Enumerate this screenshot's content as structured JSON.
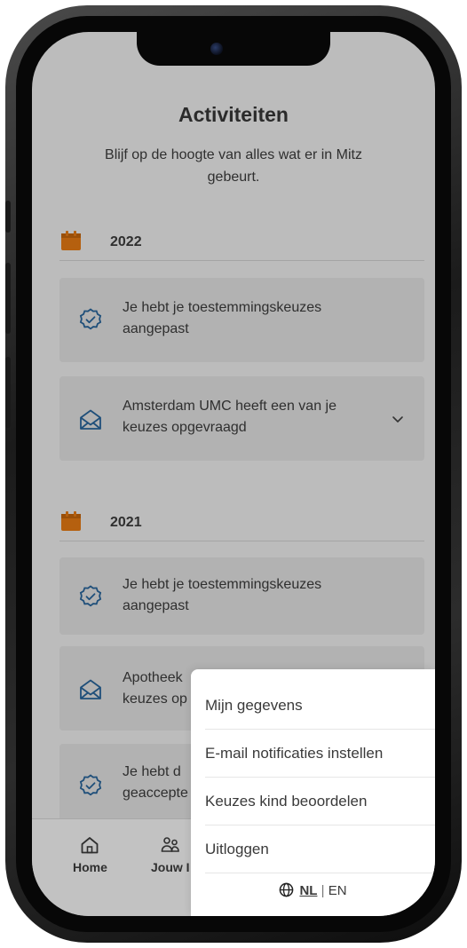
{
  "header": {
    "title": "Activiteiten",
    "subtitle": "Blijf op de hoogte van alles wat er in Mitz gebeurt."
  },
  "groups": [
    {
      "year": "2022",
      "items": [
        {
          "icon": "badge-check-icon",
          "text": "Je hebt je toestemmingskeuzes aangepast",
          "expandable": false
        },
        {
          "icon": "envelope-open-icon",
          "text": "Amsterdam UMC heeft een van je keuzes opgevraagd",
          "expandable": true
        }
      ]
    },
    {
      "year": "2021",
      "items": [
        {
          "icon": "badge-check-icon",
          "text": "Je hebt je toestemmingskeuzes aangepast",
          "expandable": false
        },
        {
          "icon": "envelope-open-icon",
          "text": "Apotheek",
          "text_line2": "keuzes op",
          "expandable": false
        },
        {
          "icon": "badge-check-icon",
          "text": "Je hebt d",
          "text_line2": "geaccepte",
          "expandable": false
        }
      ]
    }
  ],
  "bottom_nav": {
    "items": [
      {
        "icon": "home-icon",
        "label": "Home"
      },
      {
        "icon": "people-icon",
        "label": "Jouw I"
      }
    ]
  },
  "menu": {
    "items": [
      "Mijn gegevens",
      "E-mail notificaties instellen",
      "Keuzes kind beoordelen",
      "Uitloggen"
    ],
    "language": {
      "icon": "globe-icon",
      "active": "NL",
      "separator": "|",
      "other": "EN"
    }
  },
  "colors": {
    "accent_orange": "#b5600f",
    "icon_blue": "#1f4f7a",
    "overlay_gray": "#bcbcbc",
    "card_gray": "#b2b2b2"
  }
}
